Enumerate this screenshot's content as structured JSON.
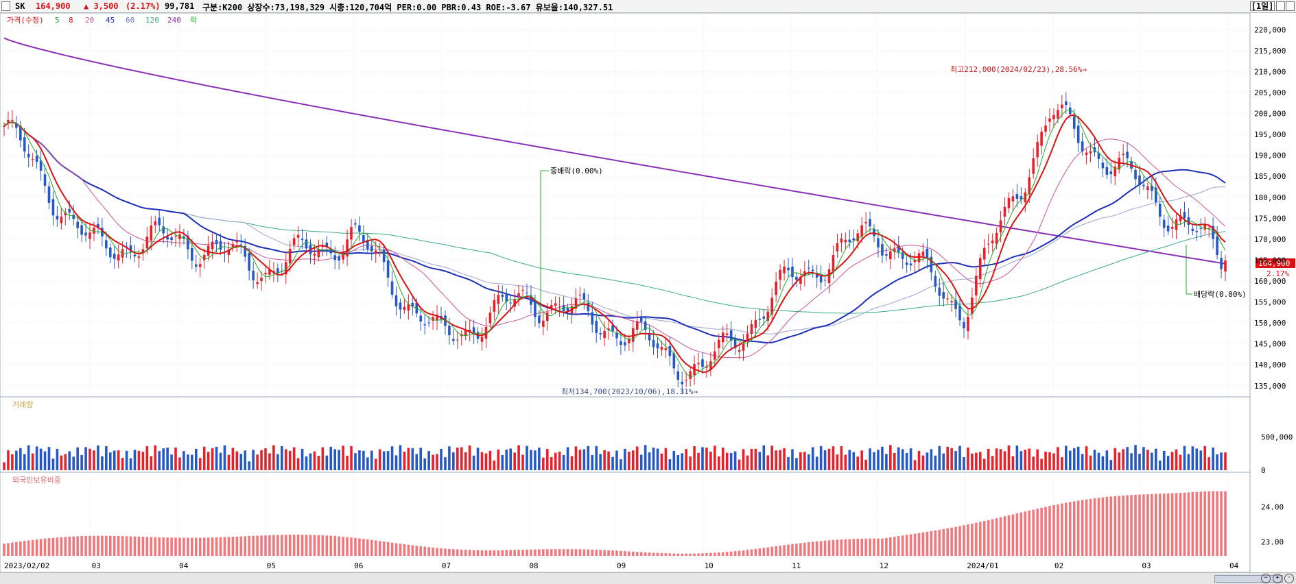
{
  "header": {
    "stock_name": "SK",
    "price": "164,900",
    "change": "▲ 3,500",
    "change_pct": "(2.17%)",
    "volume": "99,781",
    "info": "구분:K200 상장수:73,198,329 시총:120,704억 PER:0.00 PBR:0.43 ROE:-3.67 유보율:140,327.51",
    "period_button": "[1일]"
  },
  "colors": {
    "up": "#e8202a",
    "down": "#2458c8",
    "ma5": "#22aa22",
    "ma8": "#dd1111",
    "ma20": "#cc5599",
    "ma45": "#1c2fb8",
    "ma60": "#9aa3d8",
    "ma120": "#3bab7f",
    "ma240": "#8a2fb8",
    "foreign_bar": "#f0787c",
    "grid": "#c8d0e0",
    "price_box": "#dd1111"
  },
  "price_pane": {
    "legend": [
      {
        "text": "가격(수정)",
        "color": "#dd1111"
      },
      {
        "text": "5",
        "color": "#22aa22"
      },
      {
        "text": "8",
        "color": "#dd1111"
      },
      {
        "text": "20",
        "color": "#cc5599"
      },
      {
        "text": "45",
        "color": "#1c2fb8"
      },
      {
        "text": "60",
        "color": "#6a7ad0"
      },
      {
        "text": "120",
        "color": "#3bab7f"
      },
      {
        "text": "240",
        "color": "#8a2fb8"
      },
      {
        "text": "락",
        "color": "#22aa22"
      }
    ],
    "y_ticks": [
      "220,000",
      "215,000",
      "210,000",
      "205,000",
      "200,000",
      "195,000",
      "190,000",
      "185,000",
      "180,000",
      "175,000",
      "170,000",
      "165,000",
      "160,000",
      "155,000",
      "150,000",
      "145,000",
      "140,000",
      "135,000"
    ],
    "annotations": {
      "high": "최고212,000(2024/02/23),28.56%→",
      "low": "최저134,700(2023/10/06),18.31%→",
      "stock_dividend": "중배락(0.00%)",
      "dividend": "배당락(0.00%)",
      "current_price": "164,900",
      "current_pct": "2.17%"
    }
  },
  "volume_pane": {
    "title": "거래량",
    "y_ticks": [
      "500,000",
      "0"
    ]
  },
  "foreign_pane": {
    "title": "외국인보유비중",
    "y_ticks": [
      "24.00",
      "23.00"
    ]
  },
  "x_axis": {
    "labels": [
      "2023/02/02",
      "03",
      "04",
      "05",
      "06",
      "07",
      "08",
      "09",
      "10",
      "11",
      "12",
      "2024/01",
      "02",
      "03",
      "04"
    ]
  },
  "chart_data": {
    "type": "candlestick",
    "ylim_price": [
      133000,
      223000
    ],
    "monthly_trend": {
      "months": [
        "2023/02",
        "2023/03",
        "2023/04",
        "2023/05",
        "2023/06",
        "2023/07",
        "2023/08",
        "2023/09",
        "2023/10",
        "2023/11",
        "2023/12",
        "2024/01",
        "2024/02",
        "2024/03",
        "2024/04"
      ],
      "approx_close": [
        197000,
        168000,
        170000,
        163000,
        171000,
        146000,
        156000,
        149000,
        138000,
        160000,
        172000,
        153000,
        200000,
        183000,
        164900
      ]
    },
    "ma240_endpoints": [
      218000,
      164000
    ],
    "high": {
      "value": 212000,
      "date": "2024/02/23"
    },
    "low": {
      "value": 134700,
      "date": "2023/10/06"
    },
    "last": {
      "close": 164900,
      "change": 3500,
      "change_pct": 2.17
    }
  }
}
